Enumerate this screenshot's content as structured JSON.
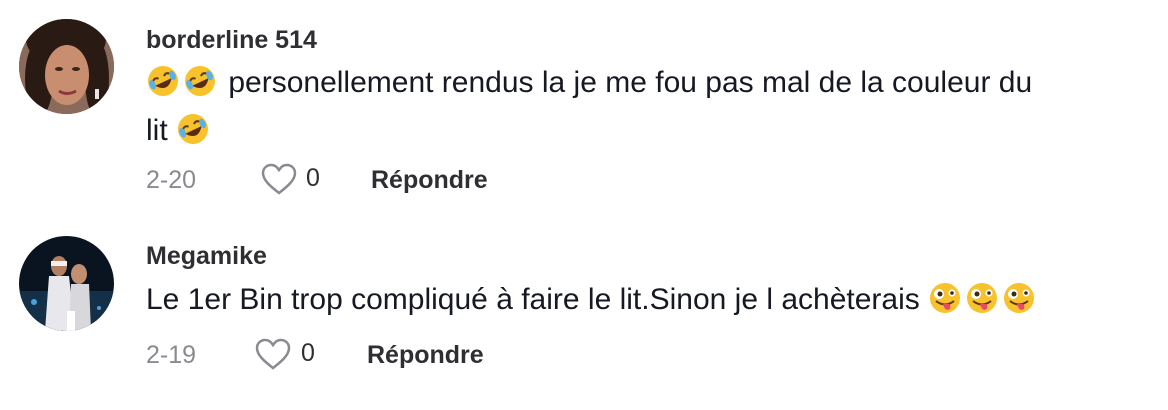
{
  "comments": [
    {
      "username": "borderline 514",
      "text_line1": "personellement rendus la je me fou pas mal de la couleur du",
      "text_line2": "lit",
      "date": "2-20",
      "likes": "0",
      "reply_label": "Répondre",
      "emojis": [
        "rolling-on-floor-laughing",
        "rolling-on-floor-laughing",
        "rolling-on-floor-laughing"
      ]
    },
    {
      "username": "Megamike",
      "text": "Le 1er Bin trop compliqué à faire le lit.Sinon je l achèterais",
      "date": "2-19",
      "likes": "0",
      "reply_label": "Répondre",
      "emojis": [
        "zany-face",
        "zany-face",
        "zany-face"
      ]
    }
  ],
  "colors": {
    "username": "#2f2f33",
    "body_text": "#161823",
    "muted": "#8a8b91",
    "emoji_yellow": "#f8c22d"
  }
}
